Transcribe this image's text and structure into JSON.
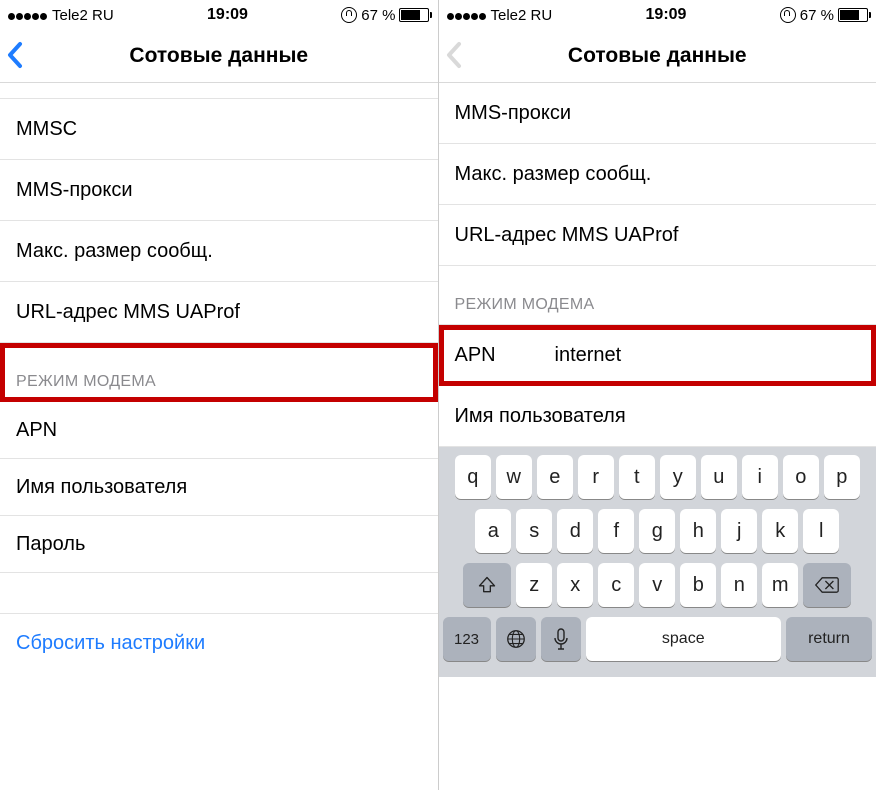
{
  "left": {
    "status": {
      "carrier": "Tele2 RU",
      "time": "19:09",
      "battery": "67 %"
    },
    "nav": {
      "title": "Сотовые данные"
    },
    "rows": {
      "mmsc": "MMSC",
      "mmsproxy": "MMS-прокси",
      "maxsize": "Макс. размер сообщ.",
      "uaprof": "URL-адрес MMS UAProf",
      "section": "РЕЖИМ МОДЕМА",
      "apn": "APN",
      "user": "Имя пользователя",
      "pass": "Пароль",
      "reset": "Сбросить настройки"
    }
  },
  "right": {
    "status": {
      "carrier": "Tele2 RU",
      "time": "19:09",
      "battery": "67 %"
    },
    "nav": {
      "title": "Сотовые данные"
    },
    "rows": {
      "mmsproxy": "MMS-прокси",
      "maxsize": "Макс. размер сообщ.",
      "uaprof": "URL-адрес MMS UAProf",
      "section": "РЕЖИМ МОДЕМА",
      "apn_lbl": "APN",
      "apn_val": "internet",
      "user": "Имя пользователя"
    },
    "kb": {
      "r1": [
        "q",
        "w",
        "e",
        "r",
        "t",
        "y",
        "u",
        "i",
        "o",
        "p"
      ],
      "r2": [
        "a",
        "s",
        "d",
        "f",
        "g",
        "h",
        "j",
        "k",
        "l"
      ],
      "r3": [
        "z",
        "x",
        "c",
        "v",
        "b",
        "n",
        "m"
      ],
      "num": "123",
      "space": "space",
      "ret": "return"
    }
  }
}
